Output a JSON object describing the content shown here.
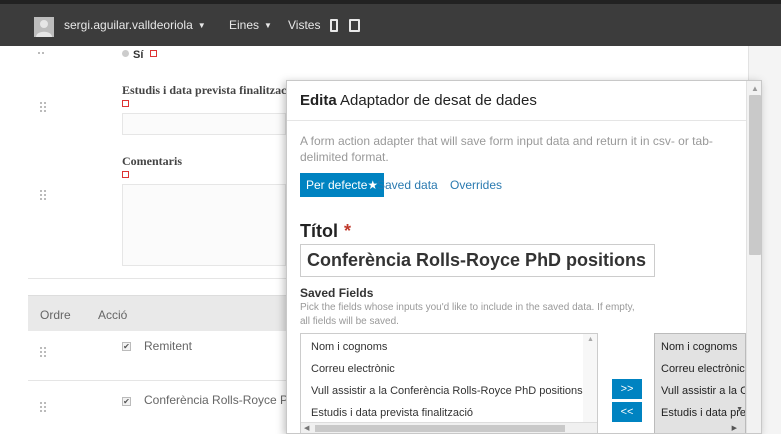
{
  "toolbar": {
    "user_name": "sergi.aguilar.valldeoriola",
    "tools_label": "Eines",
    "views_label": "Vistes"
  },
  "form": {
    "radio_option": "Sí",
    "field_studies_label": "Estudis i data prevista finalitzac",
    "field_comments_label": "Comentaris"
  },
  "table": {
    "col_order": "Ordre",
    "col_action": "Acció",
    "rows": [
      {
        "label": "Remitent",
        "checked": true
      },
      {
        "label": "Conferència Rolls-Royce P",
        "checked": true
      }
    ]
  },
  "modal": {
    "title_action": "Edita",
    "title_name": "Adaptador de desat de dades",
    "description": "A form action adapter that will save form input data and return it in csv- or tab-delimited format.",
    "tabs": [
      "Per defecte",
      "Saved data",
      "Overrides"
    ],
    "active_tab_marker": "★",
    "title_field_label": "Títol",
    "required_marker": "*",
    "title_value": "Conferència Rolls-Royce PhD positions",
    "saved_fields_label": "Saved Fields",
    "saved_fields_help": "Pick the fields whose inputs you'd like to include in the saved data. If empty, all fields will be saved.",
    "available_fields": [
      "Nom i cognoms",
      "Correu electrònic",
      "Vull assistir a la Conferència Rolls-Royce PhD positions",
      "Estudis i data prevista finalització"
    ],
    "selected_fields": [
      "Nom i cognoms",
      "Correu electrònic",
      "Vull assistir a la C",
      "Estudis i data pre"
    ],
    "add_button": ">>",
    "remove_button": "<<"
  },
  "colors": {
    "toolbar_bg": "#3c3c3c",
    "accent": "#0083c1",
    "link": "#2a7ab0",
    "required": "#c0392b"
  }
}
